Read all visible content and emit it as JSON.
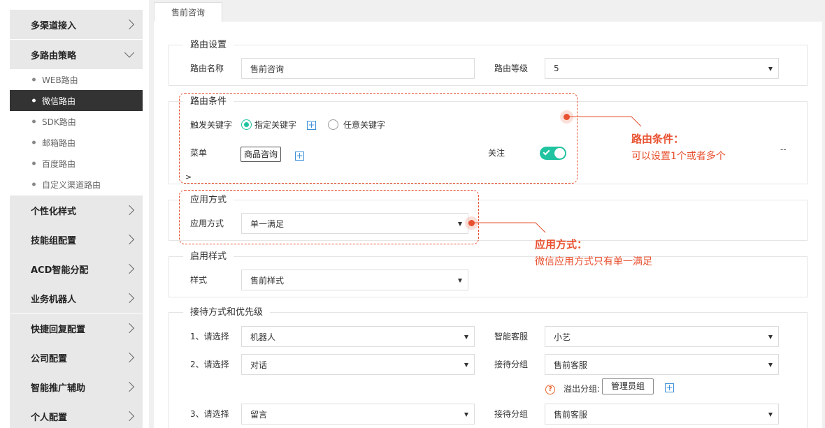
{
  "sidebar": {
    "menu": [
      {
        "label": "多渠道接入"
      },
      {
        "label": "多路由策略"
      },
      {
        "label": "个性化样式"
      },
      {
        "label": "技能组配置"
      },
      {
        "label": "ACD智能分配"
      },
      {
        "label": "业务机器人"
      },
      {
        "label": "快捷回复配置"
      },
      {
        "label": "公司配置"
      },
      {
        "label": "智能推广辅助"
      },
      {
        "label": "个人配置"
      }
    ],
    "sub_items": [
      {
        "label": "WEB路由"
      },
      {
        "label": "微信路由"
      },
      {
        "label": "SDK路由"
      },
      {
        "label": "邮箱路由"
      },
      {
        "label": "百度路由"
      },
      {
        "label": "自定义渠道路由"
      }
    ]
  },
  "tab": {
    "label": "售前咨询"
  },
  "route_settings": {
    "legend": "路由设置",
    "name_label": "路由名称",
    "name_value": "售前咨询",
    "level_label": "路由等级",
    "level_value": "5"
  },
  "route_conditions": {
    "legend": "路由条件",
    "keyword_label": "触发关键字",
    "option_specific": "指定关键字",
    "option_any": "任意关键字",
    "menu_label": "菜单",
    "menu_tag": "商品咨询",
    "follow_label": "关注",
    "more_marker": ">",
    "dash": "--"
  },
  "apply_mode": {
    "legend": "应用方式",
    "label": "应用方式",
    "value": "单一满足"
  },
  "enable_style": {
    "legend": "启用样式",
    "label": "样式",
    "value": "售前样式"
  },
  "reception": {
    "legend": "接待方式和优先级",
    "rows": [
      {
        "label": "1、请选择",
        "value": "机器人",
        "right_label": "智能客服",
        "right_value": "小艺"
      },
      {
        "label": "2、请选择",
        "value": "对话",
        "right_label": "接待分组",
        "right_value": "售前客服"
      },
      {
        "label": "3、请选择",
        "value": "留言",
        "right_label": "接待分组",
        "right_value": "售前客服"
      }
    ],
    "overflow_label": "溢出分组:",
    "overflow_tag": "管理员组"
  },
  "annotations": {
    "conditions_title": "路由条件：",
    "conditions_text": "可以设置1个或者多个",
    "apply_title": "应用方式：",
    "apply_text": "微信应用方式只有单一满足"
  },
  "colors": {
    "accent": "#21c3a0",
    "annotation": "#e8502f",
    "active_nav": "#333333"
  }
}
